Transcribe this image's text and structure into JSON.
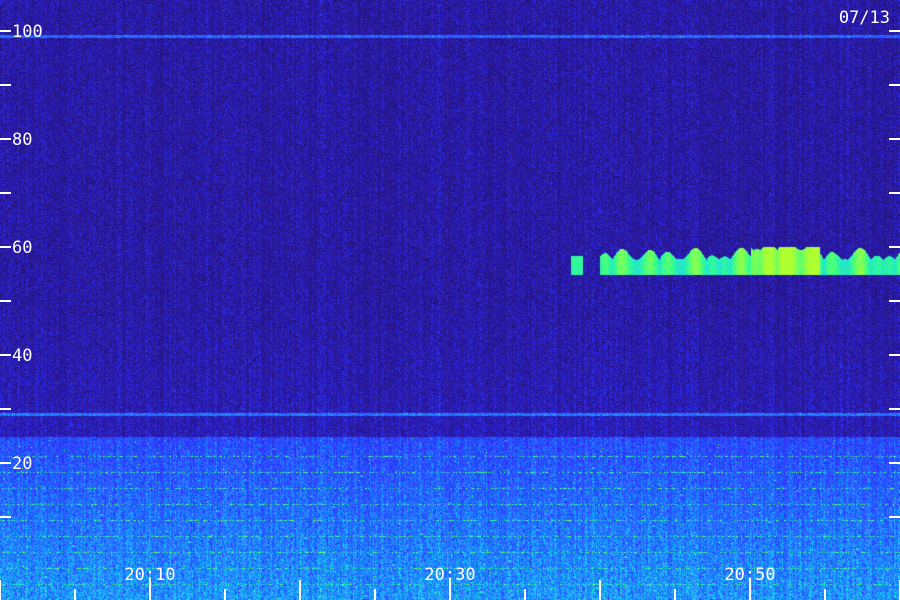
{
  "date_label": "07/13",
  "chart_data": {
    "type": "heatmap",
    "title": "",
    "xlabel": "",
    "ylabel": "",
    "ylim": [
      0,
      105
    ],
    "yticks": [
      100,
      90,
      80,
      70,
      60,
      50,
      40,
      30,
      20,
      10
    ],
    "ytick_labels": [
      {
        "value": 100,
        "label": "100"
      },
      {
        "value": 80,
        "label": "80"
      },
      {
        "value": 60,
        "label": "60"
      },
      {
        "value": 40,
        "label": "40"
      },
      {
        "value": 20,
        "label": "20"
      }
    ],
    "x_time_labels": [
      "20:10",
      "20:30",
      "20:50"
    ],
    "grid": false,
    "colormap": [
      "#1e1050",
      "#2a18a0",
      "#3030ff",
      "#1f7fff",
      "#1ad0ff",
      "#30ff90",
      "#b0ff30"
    ],
    "features": [
      {
        "name": "emission-band",
        "from_time": "20:36",
        "to_time": "21:00",
        "y_range": [
          55,
          60
        ]
      },
      {
        "name": "constant-line",
        "y": 99
      },
      {
        "name": "constant-line",
        "y": 29
      },
      {
        "name": "low-frequency-noise",
        "y_range": [
          0,
          25
        ]
      }
    ]
  }
}
